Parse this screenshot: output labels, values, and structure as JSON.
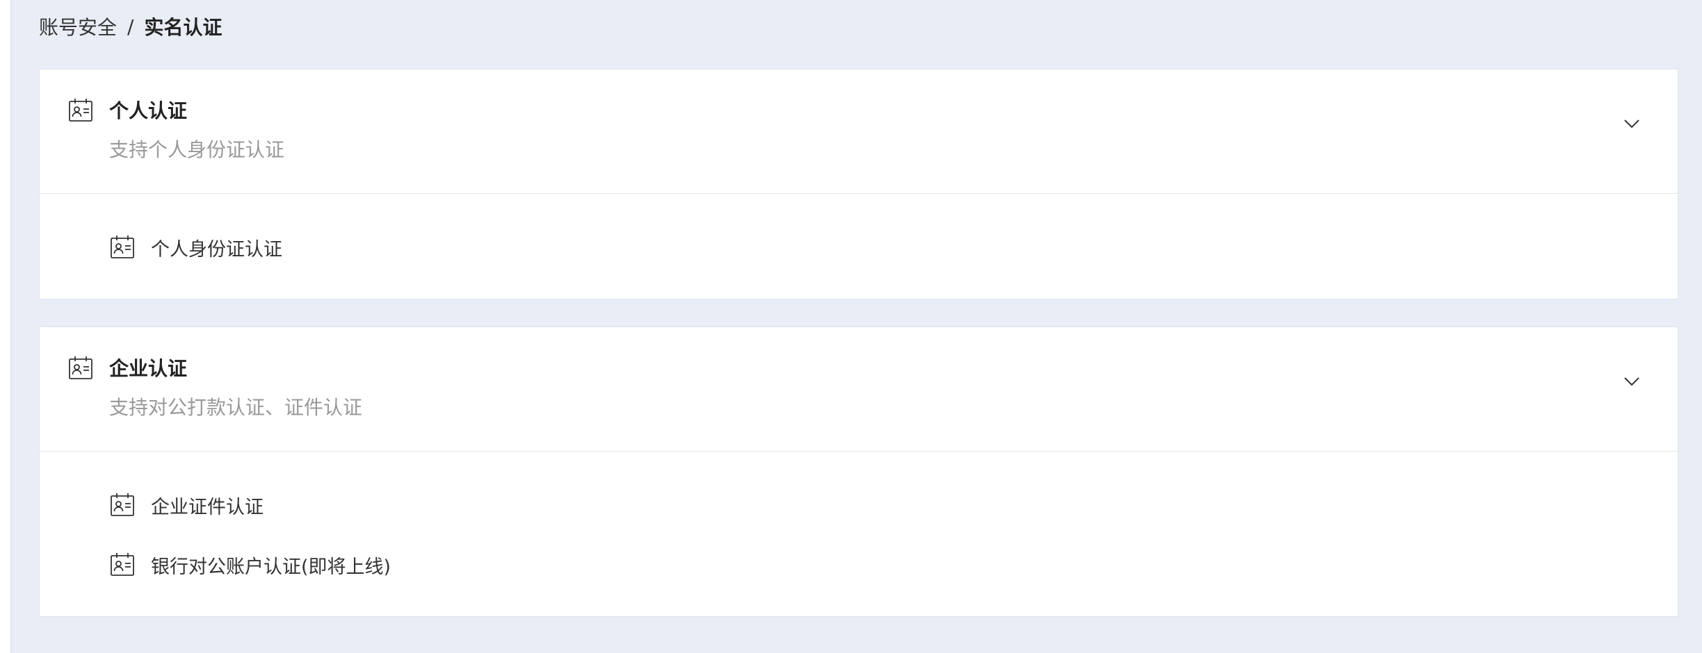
{
  "breadcrumb": {
    "parent": "账号安全",
    "separator": "/",
    "current": "实名认证"
  },
  "sections": [
    {
      "title": "个人认证",
      "subtitle": "支持个人身份证认证",
      "icon": "id-card-icon",
      "expanded": true,
      "options": [
        {
          "label": "个人身份证认证",
          "icon": "id-card-icon"
        }
      ]
    },
    {
      "title": "企业认证",
      "subtitle": "支持对公打款认证、证件认证",
      "icon": "id-card-icon",
      "expanded": true,
      "options": [
        {
          "label": "企业证件认证",
          "icon": "id-card-icon"
        },
        {
          "label": "银行对公账户认证(即将上线)",
          "icon": "id-card-icon"
        }
      ]
    }
  ],
  "colors": {
    "page_background": "#e9edf5",
    "card_background": "#ffffff",
    "title_text": "#222222",
    "subtitle_text": "#999999",
    "body_text": "#333333"
  }
}
